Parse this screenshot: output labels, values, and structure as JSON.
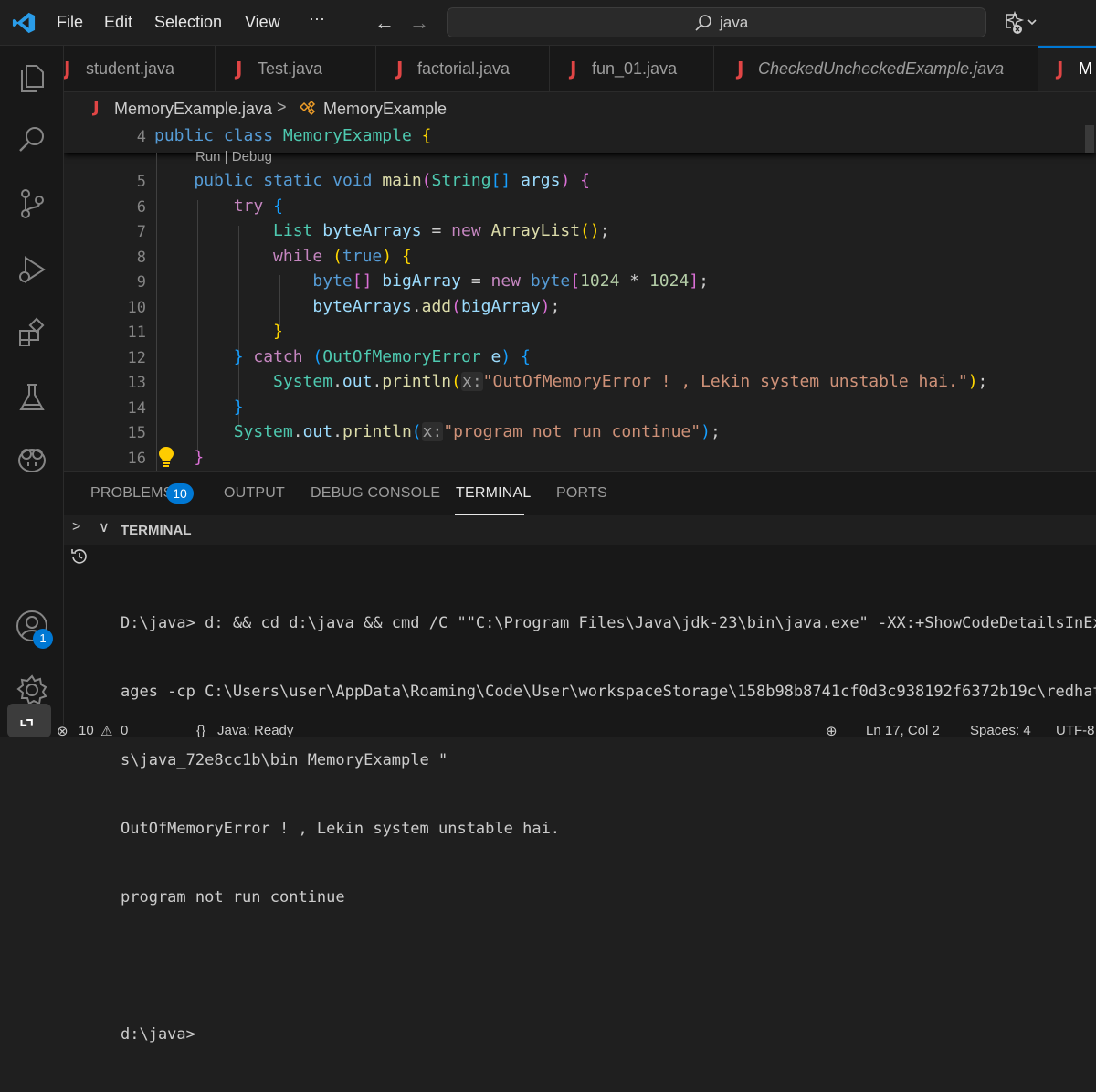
{
  "titlebar": {
    "menu": [
      "File",
      "Edit",
      "Selection",
      "View",
      "···"
    ],
    "search_value": "java"
  },
  "tabs": [
    {
      "label": "student.java",
      "italic": false
    },
    {
      "label": "Test.java",
      "italic": false
    },
    {
      "label": "factorial.java",
      "italic": false
    },
    {
      "label": "fun_01.java",
      "italic": false
    },
    {
      "label": "CheckedUncheckedExample.java",
      "italic": true
    },
    {
      "label": "M",
      "italic": false,
      "active": true
    }
  ],
  "tab_file_glyph": "J",
  "breadcrumb": {
    "file": "MemoryExample.java",
    "separator": ">",
    "symbol": "MemoryExample"
  },
  "editor": {
    "line_numbers": [
      "4",
      "5",
      "6",
      "7",
      "8",
      "9",
      "10",
      "11",
      "12",
      "13",
      "14",
      "15",
      "16"
    ],
    "codelens": "Run | Debug",
    "tokens": {
      "public": "public",
      "class": "class",
      "class_name": "MemoryExample",
      "static": "static",
      "void": "void",
      "main": "main",
      "String": "String",
      "args": "args",
      "try": "try",
      "List": "List",
      "byteArrays": "byteArrays",
      "new": "new",
      "ArrayList": "ArrayList",
      "while": "while",
      "true": "true",
      "byte": "byte",
      "bigArray": "bigArray",
      "n1024": "1024",
      "add": "add",
      "catch": "catch",
      "OutOfMemoryError": "OutOfMemoryError",
      "e": "e",
      "System": "System",
      "out": "out",
      "println": "println",
      "hint_x": "x:",
      "str1": "\"OutOfMemoryError ! , Lekin system unstable hai.\"",
      "str2": "\"program not run continue\""
    }
  },
  "panel": {
    "tabs": [
      "PROBLEMS",
      "OUTPUT",
      "DEBUG CONSOLE",
      "TERMINAL",
      "PORTS"
    ],
    "problems_count": "10",
    "active_tab": "TERMINAL",
    "terminal_section_title": "TERMINAL",
    "terminal_lines": [
      "D:\\java> d: && cd d:\\java && cmd /C \"\"C:\\Program Files\\Java\\jdk-23\\bin\\java.exe\" -XX:+ShowCodeDetailsInExceptionMess",
      "ages -cp C:\\Users\\user\\AppData\\Roaming\\Code\\User\\workspaceStorage\\158b98b8741cf0d3c938192f6372b19c\\redhat.java\\jdt_w",
      "s\\java_72e8cc1b\\bin MemoryExample \"",
      "OutOfMemoryError ! , Lekin system unstable hai.",
      "program not run continue",
      "",
      "d:\\java>"
    ]
  },
  "activitybar": {
    "accounts_badge": "1"
  },
  "statusbar": {
    "errors": "10",
    "warnings": "0",
    "java_status": "Java: Ready",
    "position": "Ln 17, Col 2",
    "spaces": "Spaces: 4",
    "encoding": "UTF-8"
  },
  "colors": {
    "accent": "#0078d4",
    "java_icon": "#e04545",
    "editor_bg": "#1f1f1f",
    "panel_bg": "#181818"
  }
}
